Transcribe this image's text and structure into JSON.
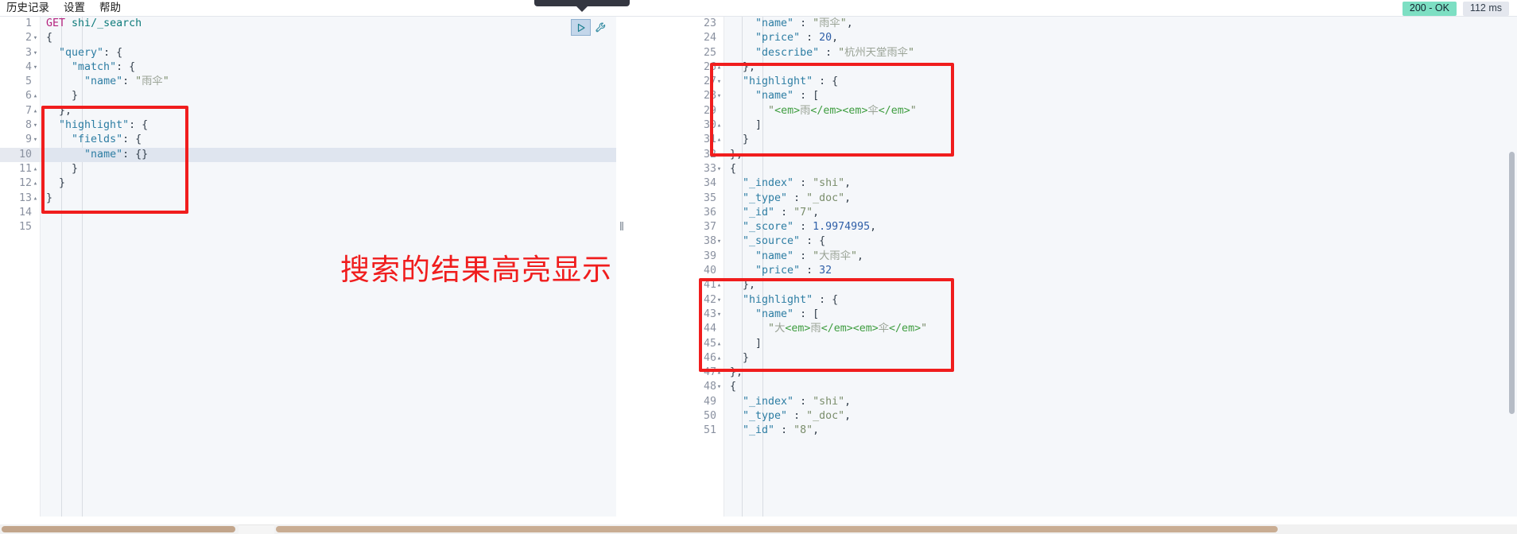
{
  "menu": {
    "items": [
      {
        "label": "历史记录",
        "name": "menu-history"
      },
      {
        "label": "设置",
        "name": "menu-settings"
      },
      {
        "label": "帮助",
        "name": "menu-help"
      }
    ]
  },
  "status": {
    "code": "200 - OK",
    "duration": "112 ms",
    "ok_color": "#7ddfc3",
    "time_bg": "#e4e7ee"
  },
  "actions": {
    "play_label": "▷",
    "wrench_label": "wrench"
  },
  "annotation": {
    "text": "搜索的结果高亮显示",
    "color": "#f01d1d"
  },
  "request": {
    "lines": [
      {
        "n": "1",
        "fold": "",
        "text": "GET shi/_search"
      },
      {
        "n": "2",
        "fold": "▾",
        "text": "{"
      },
      {
        "n": "3",
        "fold": "▾",
        "text": "  \"query\": {"
      },
      {
        "n": "4",
        "fold": "▾",
        "text": "    \"match\": {"
      },
      {
        "n": "5",
        "fold": "",
        "text": "      \"name\": \"雨伞\""
      },
      {
        "n": "6",
        "fold": "▴",
        "text": "    }"
      },
      {
        "n": "7",
        "fold": "▴",
        "text": "  },"
      },
      {
        "n": "8",
        "fold": "▾",
        "text": "  \"highlight\": {"
      },
      {
        "n": "9",
        "fold": "▾",
        "text": "    \"fields\": {"
      },
      {
        "n": "10",
        "fold": "",
        "text": "      \"name\": {}"
      },
      {
        "n": "11",
        "fold": "▴",
        "text": "    }"
      },
      {
        "n": "12",
        "fold": "▴",
        "text": "  }"
      },
      {
        "n": "13",
        "fold": "▴",
        "text": "}"
      },
      {
        "n": "14",
        "fold": "",
        "text": ""
      },
      {
        "n": "15",
        "fold": "",
        "text": ""
      }
    ],
    "active_line": "10"
  },
  "response": {
    "lines": [
      {
        "n": "23",
        "fold": "",
        "text": "    \"name\" : \"雨伞\","
      },
      {
        "n": "24",
        "fold": "",
        "text": "    \"price\" : 20,"
      },
      {
        "n": "25",
        "fold": "",
        "text": "    \"describe\" : \"杭州天堂雨伞\""
      },
      {
        "n": "26",
        "fold": "▴",
        "text": "  },"
      },
      {
        "n": "27",
        "fold": "▾",
        "text": "  \"highlight\" : {"
      },
      {
        "n": "28",
        "fold": "▾",
        "text": "    \"name\" : ["
      },
      {
        "n": "29",
        "fold": "",
        "text": "      \"<em>雨</em><em>伞</em>\""
      },
      {
        "n": "30",
        "fold": "▴",
        "text": "    ]"
      },
      {
        "n": "31",
        "fold": "▴",
        "text": "  }"
      },
      {
        "n": "32",
        "fold": "▴",
        "text": "},"
      },
      {
        "n": "33",
        "fold": "▾",
        "text": "{"
      },
      {
        "n": "34",
        "fold": "",
        "text": "  \"_index\" : \"shi\","
      },
      {
        "n": "35",
        "fold": "",
        "text": "  \"_type\" : \"_doc\","
      },
      {
        "n": "36",
        "fold": "",
        "text": "  \"_id\" : \"7\","
      },
      {
        "n": "37",
        "fold": "",
        "text": "  \"_score\" : 1.9974995,"
      },
      {
        "n": "38",
        "fold": "▾",
        "text": "  \"_source\" : {"
      },
      {
        "n": "39",
        "fold": "",
        "text": "    \"name\" : \"大雨伞\","
      },
      {
        "n": "40",
        "fold": "",
        "text": "    \"price\" : 32"
      },
      {
        "n": "41",
        "fold": "▴",
        "text": "  },"
      },
      {
        "n": "42",
        "fold": "▾",
        "text": "  \"highlight\" : {"
      },
      {
        "n": "43",
        "fold": "▾",
        "text": "    \"name\" : ["
      },
      {
        "n": "44",
        "fold": "",
        "text": "      \"大<em>雨</em><em>伞</em>\""
      },
      {
        "n": "45",
        "fold": "▴",
        "text": "    ]"
      },
      {
        "n": "46",
        "fold": "▴",
        "text": "  }"
      },
      {
        "n": "47",
        "fold": "▴",
        "text": "},"
      },
      {
        "n": "48",
        "fold": "▾",
        "text": "{"
      },
      {
        "n": "49",
        "fold": "",
        "text": "  \"_index\" : \"shi\","
      },
      {
        "n": "50",
        "fold": "",
        "text": "  \"_type\" : \"_doc\","
      },
      {
        "n": "51",
        "fold": "",
        "text": "  \"_id\" : \"8\","
      }
    ]
  }
}
